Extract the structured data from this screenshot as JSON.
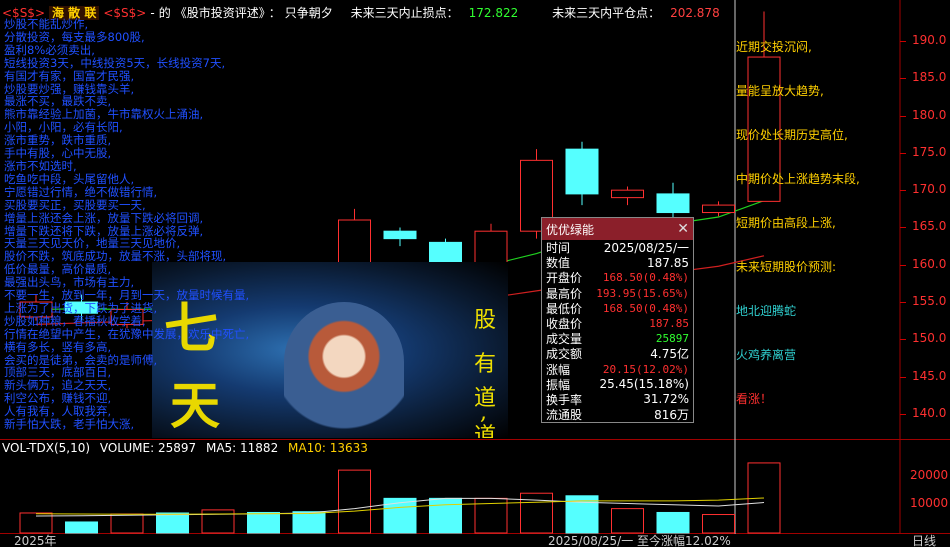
{
  "title_bar": {
    "stock_code": "<$S$>",
    "stock_name": "海 散 联",
    "stock_code_end": "<$S$>",
    "sep": "-",
    "of": "的",
    "book": "《股市投资评述》",
    "colon1": "：",
    "motto": "只争朝夕",
    "stop_label": "未来三天内止损点：",
    "stop_value": "172.822",
    "close_label": "未来三天内平仓点：",
    "close_value": "202.878"
  },
  "left_text": [
    "炒股不能乱炒作,",
    "分散投资，每支最多800股,",
    "盈利8%必须卖出,",
    "短线投资3天，中线投资5天，长线投资7天,",
    "有国才有家，国富才民强,",
    "炒股要炒强，赚钱靠头羊,",
    "最涨不买，最跌不卖,",
    "熊市靠经验上加菌，牛市靠权火上涌油,",
    "小阳，小阳，必有长阳,",
    "涨市重势，跌市重质,",
    "手中有股，心中无股,",
    "涨市不如选时,",
    "吃鱼吃中段，头尾留他人,",
    "宁愿错过行情，绝不做错行情,",
    "买股要买正，买股要买一天,",
    "增量上涨还会上涨，放量下跌必将回调,",
    "增量下跌还将下跌，放量上涨必将反弹,",
    "天量三天见天价，地量三天见地价,",
    "股价不跌，筑底成功，放量不涨，头部将现,",
    "低价最量，高价最质,",
    "最强出头鸟，市场有主力,",
    "不要一生，放到一年，月到一天，放量时候有量,",
    "上涨为了出货，下跌为了进货,",
    "炒股如种粮，春播秋收学着,",
    "行情在绝望中产生，在犹豫中发展，欢乐中死亡,",
    "横有多长，竖有多高,",
    "会买的是徒弟，会卖的是师傅,",
    "顶部三天，底部百日,",
    "新头俩万，追之天天,",
    "利空公布，赚钱不迎,",
    "人有我有，人取我弃,",
    "新手怕大跌，老手怕大涨,"
  ],
  "y_axis": {
    "ticks": [
      "190.0",
      "185.0",
      "180.0",
      "175.0",
      "170.0",
      "165.0",
      "160.0",
      "155.0",
      "150.0",
      "145.0",
      "140.0"
    ]
  },
  "right_notes": [
    {
      "text": "近期交投沉闷,",
      "color": "#ffd000"
    },
    {
      "text": "量能呈放大趋势,",
      "color": "#ffd000"
    },
    {
      "text": "现价处长期历史高位,",
      "color": "#ffd000"
    },
    {
      "text": "中期价处上涨趋势末段,",
      "color": "#ffd000"
    },
    {
      "text": "短期价由高段上涨,",
      "color": "#ffd000"
    },
    {
      "text": "未来短期股价预测:",
      "color": "#ffd000"
    },
    {
      "text": "地北迎腾蛇",
      "color": "#30d0d0"
    },
    {
      "text": "火鸡养离营",
      "color": "#30d0d0"
    },
    {
      "text": "看涨！",
      "color": "#ff3030"
    }
  ],
  "art": {
    "char_top": "七",
    "char_bottom": "天",
    "right_col": [
      "股",
      "有",
      "道",
      ",",
      "道"
    ]
  },
  "popup": {
    "title": "优优绿能",
    "close_label": "✕",
    "rows": [
      {
        "label": "时间",
        "value": "2025/08/25/一",
        "style": "norm"
      },
      {
        "label": "数值",
        "value": "187.85",
        "style": "norm"
      },
      {
        "label": "开盘价",
        "value": "168.50(0.48%)",
        "style": "red"
      },
      {
        "label": "最高价",
        "value": "193.95(15.65%)",
        "style": "red"
      },
      {
        "label": "最低价",
        "value": "168.50(0.48%)",
        "style": "red"
      },
      {
        "label": "收盘价",
        "value": "187.85",
        "style": "red"
      },
      {
        "label": "成交量",
        "value": "25897",
        "style": "green"
      },
      {
        "label": "成交额",
        "value": "4.75亿",
        "style": "norm"
      },
      {
        "label": "涨幅",
        "value": "20.15(12.02%)",
        "style": "red"
      },
      {
        "label": "振幅",
        "value": "25.45(15.18%)",
        "style": "norm"
      },
      {
        "label": "换手率",
        "value": "31.72%",
        "style": "norm"
      },
      {
        "label": "流通股",
        "value": "816万",
        "style": "norm"
      }
    ]
  },
  "volume": {
    "indicator": "VOL-TDX(5,10)",
    "volume_label": "VOLUME: 25897",
    "ma5_label": "MA5: 11882",
    "ma10_label": "MA10: 13633",
    "ticks": [
      "20000",
      "10000"
    ]
  },
  "bottom": {
    "left": "2025年",
    "mid": "2025/08/25/一  至今涨幅12.02%",
    "right": "日线"
  },
  "colors": {
    "up": "#ff3030",
    "down": "#55ffff",
    "ma_green": "#20d020",
    "ma_red": "#d02020",
    "vol_ma_white": "#e0e0e0",
    "vol_ma_yellow": "#e0d000"
  },
  "chart_data": {
    "type": "candlestick",
    "price_ylim": [
      136.5,
      195.5
    ],
    "candles": [
      {
        "open": 153.0,
        "close": 155.0,
        "high": 156.0,
        "low": 152.5
      },
      {
        "open": 155.0,
        "close": 153.5,
        "high": 156.0,
        "low": 152.5
      },
      {
        "open": 152.0,
        "close": 154.0,
        "high": 155.0,
        "low": 151.5
      },
      {
        "open": 155.0,
        "close": 153.0,
        "high": 156.0,
        "low": 152.0
      },
      {
        "open": 153.0,
        "close": 155.0,
        "high": 156.5,
        "low": 152.5
      },
      {
        "open": 155.0,
        "close": 154.0,
        "high": 156.0,
        "low": 153.5
      },
      {
        "open": 154.5,
        "close": 152.5,
        "high": 155.0,
        "low": 152.0
      },
      {
        "open": 152.0,
        "close": 166.0,
        "high": 167.5,
        "low": 151.5
      },
      {
        "open": 164.5,
        "close": 163.5,
        "high": 165.0,
        "low": 162.5
      },
      {
        "open": 163.0,
        "close": 157.5,
        "high": 163.5,
        "low": 156.5
      },
      {
        "open": 157.0,
        "close": 164.5,
        "high": 165.5,
        "low": 156.0
      },
      {
        "open": 164.5,
        "close": 174.0,
        "high": 175.5,
        "low": 163.5
      },
      {
        "open": 175.5,
        "close": 169.5,
        "high": 176.5,
        "low": 168.0
      },
      {
        "open": 169.0,
        "close": 170.0,
        "high": 170.5,
        "low": 168.0
      },
      {
        "open": 169.5,
        "close": 167.0,
        "high": 171.0,
        "low": 166.0
      },
      {
        "open": 167.0,
        "close": 168.0,
        "high": 168.5,
        "low": 166.5
      },
      {
        "open": 168.5,
        "close": 187.85,
        "high": 193.95,
        "low": 168.5
      }
    ],
    "ma_green": [
      154.0,
      154.1,
      154.0,
      154.1,
      154.3,
      154.5,
      154.8,
      155.6,
      157.2,
      158.5,
      160.0,
      161.5,
      163.5,
      164.8,
      165.5,
      166.4,
      168.6
    ],
    "ma_red": [
      152.0,
      152.2,
      152.4,
      152.6,
      152.8,
      153.1,
      153.4,
      153.8,
      154.3,
      154.9,
      155.6,
      156.5,
      157.4,
      158.2,
      159.0,
      159.8,
      161.2
    ],
    "volumes": [
      7800,
      4300,
      7400,
      7800,
      9000,
      8000,
      8300,
      24500,
      13500,
      13500,
      13500,
      15500,
      14500,
      9500,
      8000,
      7200,
      27300
    ],
    "vol_ylim": [
      0,
      30000
    ],
    "vol_ma5": [
      6600,
      6700,
      6900,
      7100,
      7300,
      7500,
      7800,
      9500,
      11800,
      13500,
      13500,
      12800,
      12000,
      11500,
      11000,
      10500,
      11882
    ],
    "vol_ma10": [
      7500,
      7400,
      7300,
      7300,
      7400,
      7500,
      7600,
      8500,
      10000,
      11000,
      11500,
      12000,
      12500,
      12500,
      12500,
      12800,
      13633
    ]
  }
}
